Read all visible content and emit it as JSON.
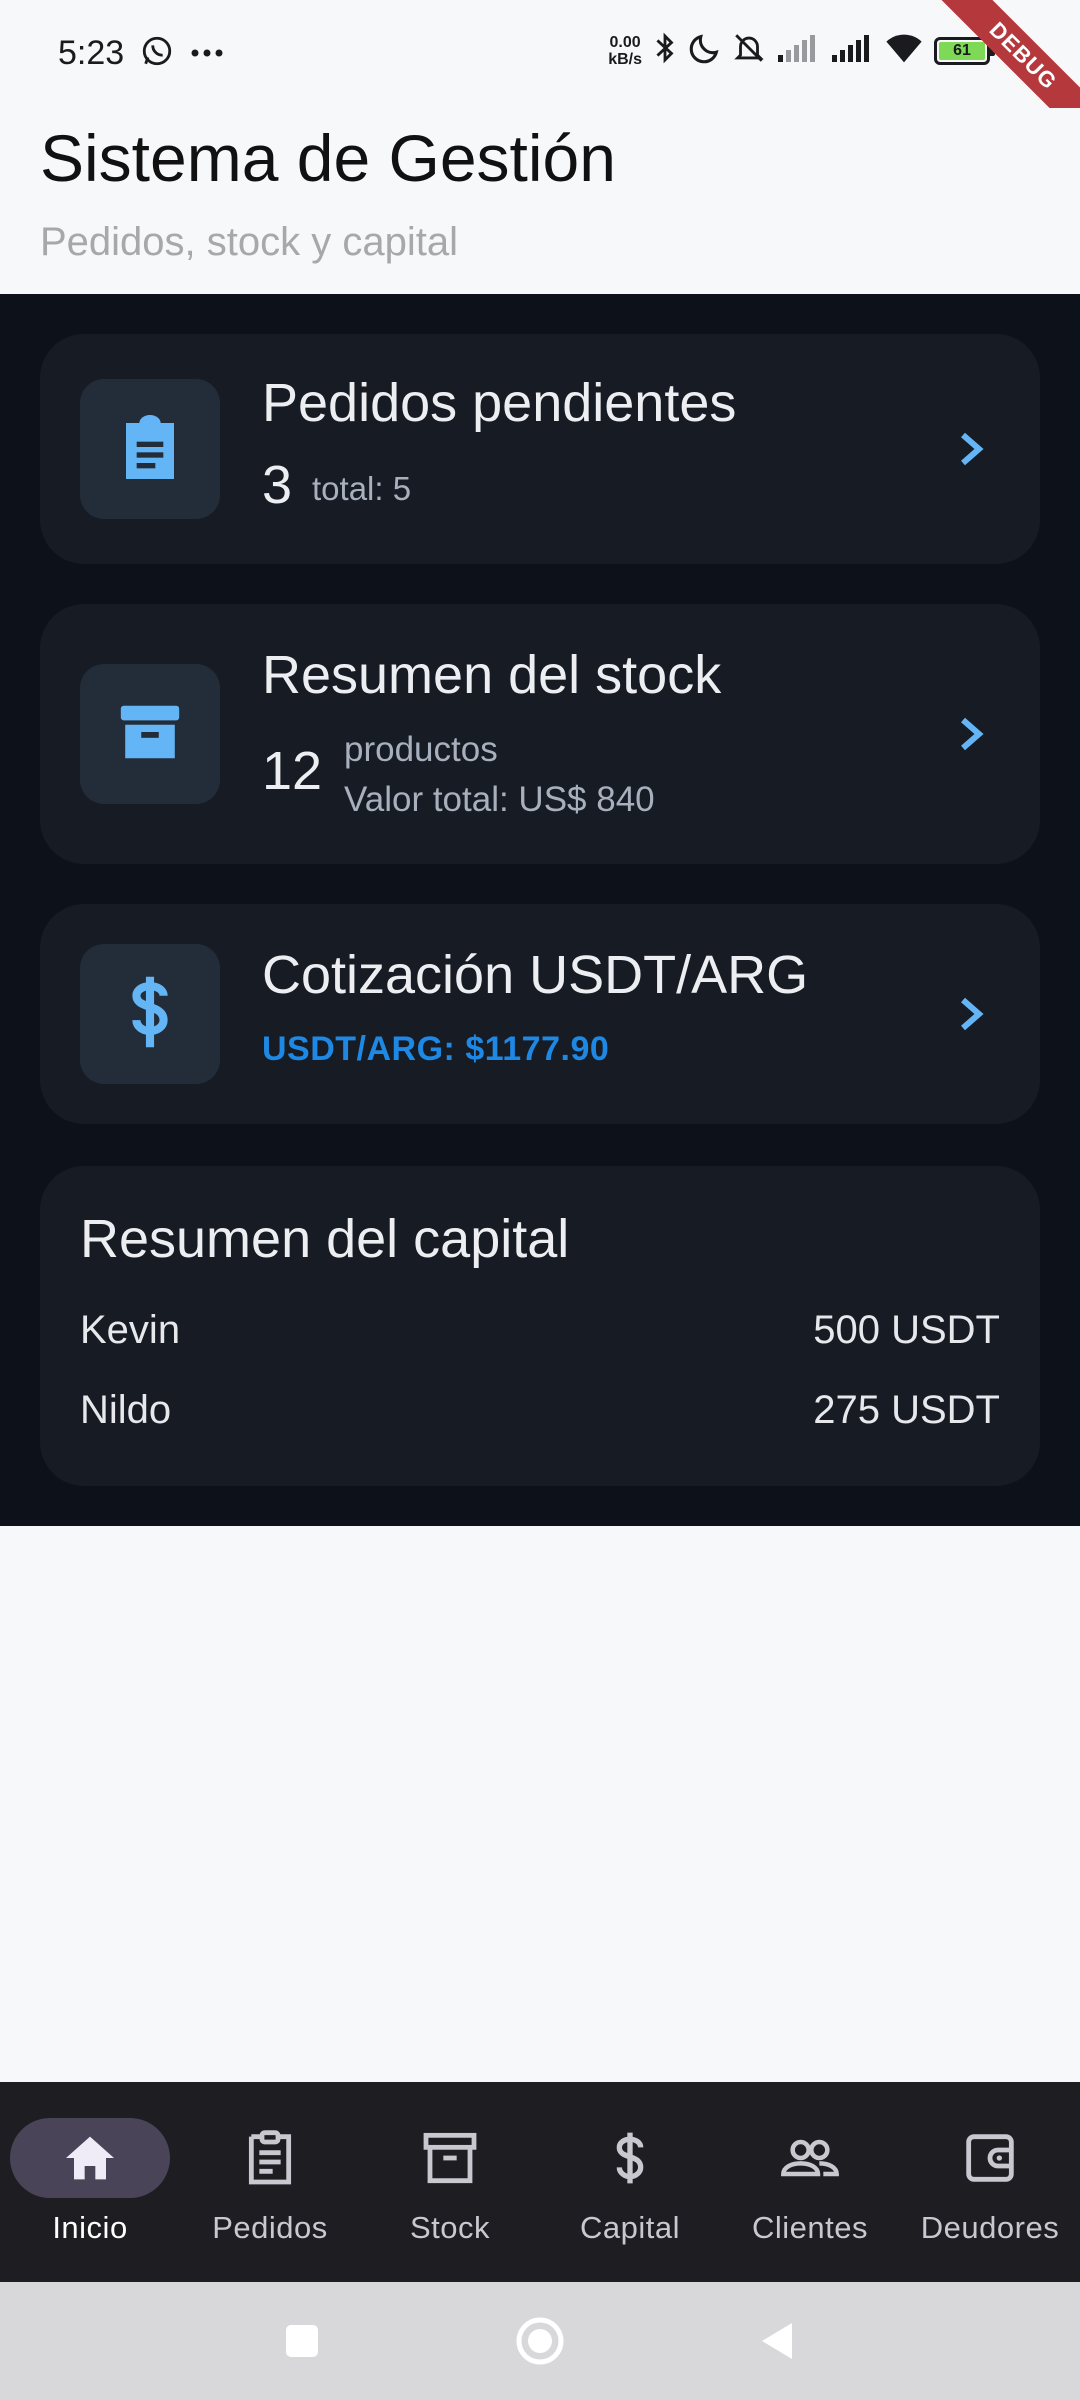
{
  "status_bar": {
    "time": "5:23",
    "net_speed_value": "0.00",
    "net_speed_unit": "kB/s",
    "battery_level": "61",
    "debug_label": "DEBUG"
  },
  "header": {
    "title": "Sistema de Gestión",
    "subtitle": "Pedidos, stock y capital"
  },
  "cards": {
    "pedidos": {
      "title": "Pedidos pendientes",
      "count": "3",
      "total_text": "total: 5",
      "icon": "clipboard-icon"
    },
    "stock": {
      "title": "Resumen del stock",
      "count": "12",
      "unit": "productos",
      "value_text": "Valor total: US$ 840",
      "icon": "archive-icon"
    },
    "cotizacion": {
      "title": "Cotización USDT/ARG",
      "rate_text": "USDT/ARG: $1177.90",
      "icon": "dollar-icon"
    }
  },
  "capital": {
    "title": "Resumen del capital",
    "rows": [
      {
        "name": "Kevin",
        "amount": "500 USDT"
      },
      {
        "name": "Nildo",
        "amount": "275 USDT"
      }
    ]
  },
  "bottom_nav": {
    "items": [
      {
        "label": "Inicio",
        "icon": "home-icon",
        "selected": true
      },
      {
        "label": "Pedidos",
        "icon": "clipboard-icon",
        "selected": false
      },
      {
        "label": "Stock",
        "icon": "archive-icon",
        "selected": false
      },
      {
        "label": "Capital",
        "icon": "dollar-icon",
        "selected": false
      },
      {
        "label": "Clientes",
        "icon": "people-icon",
        "selected": false
      },
      {
        "label": "Deudores",
        "icon": "wallet-icon",
        "selected": false
      }
    ]
  },
  "colors": {
    "accent": "#64b5f6",
    "accent_link": "#1e88e5",
    "card_bg": "#171b23",
    "content_bg": "#0d121a",
    "nav_pill": "#4a4458"
  }
}
